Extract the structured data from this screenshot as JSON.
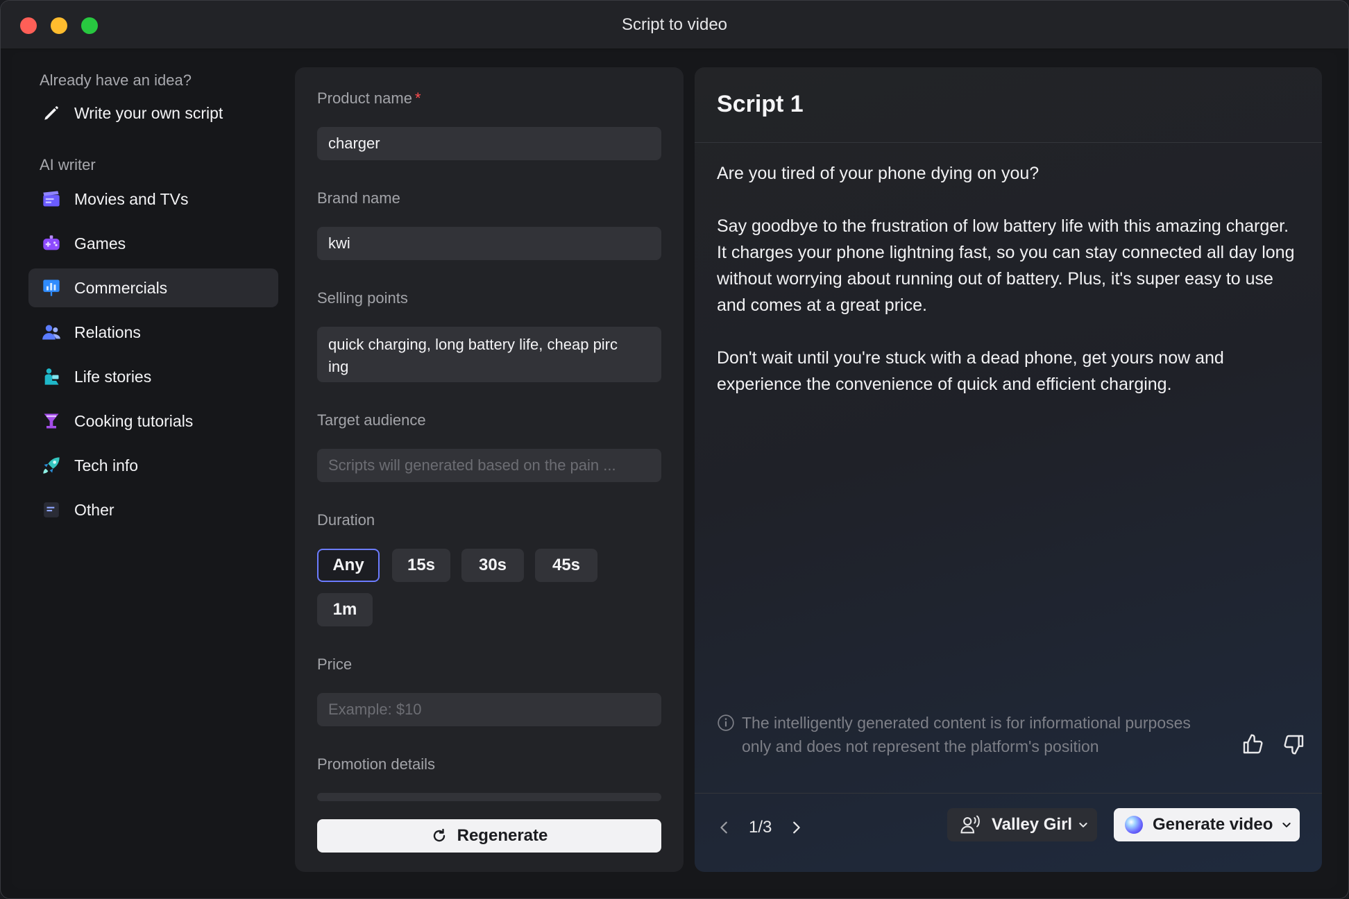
{
  "window": {
    "title": "Script to video"
  },
  "sidebar": {
    "heading_idea": "Already have an idea?",
    "write_own": "Write your own script",
    "heading_ai": "AI writer",
    "items": [
      {
        "label": "Movies and TVs",
        "icon": "clapperboard-icon",
        "active": false
      },
      {
        "label": "Games",
        "icon": "gamepad-icon",
        "active": false
      },
      {
        "label": "Commercials",
        "icon": "chart-board-icon",
        "active": true
      },
      {
        "label": "Relations",
        "icon": "people-icon",
        "active": false
      },
      {
        "label": "Life stories",
        "icon": "person-reading-icon",
        "active": false
      },
      {
        "label": "Cooking tutorials",
        "icon": "cocktail-glass-icon",
        "active": false
      },
      {
        "label": "Tech info",
        "icon": "rocket-icon",
        "active": false
      },
      {
        "label": "Other",
        "icon": "list-icon",
        "active": false
      }
    ]
  },
  "form": {
    "product_name_label": "Product name",
    "required_mark": "*",
    "product_name_value": "charger",
    "brand_name_label": "Brand name",
    "brand_name_value": "kwi",
    "selling_points_label": "Selling points",
    "selling_points_line1": "quick charging, long battery life, cheap pirc",
    "selling_points_line2": "ing",
    "target_audience_label": "Target audience",
    "target_audience_placeholder": "Scripts will generated based on the pain ...",
    "duration_label": "Duration",
    "duration_options": [
      "Any",
      "15s",
      "30s",
      "45s",
      "1m"
    ],
    "duration_selected": "Any",
    "price_label": "Price",
    "price_placeholder": "Example: $10",
    "promotion_label": "Promotion details",
    "regenerate_label": "Regenerate"
  },
  "script": {
    "title": "Script 1",
    "paragraphs": [
      "Are you tired of your phone dying on you?",
      "Say goodbye to the frustration of low battery life with this amazing charger. It charges your phone lightning fast, so you can stay connected all day long without worrying about running out of battery. Plus, it's super easy to use and comes at a great price.",
      "Don't wait until you're stuck with a dead phone, get yours now and experience the convenience of quick and efficient charging."
    ],
    "disclaimer": "The intelligently generated content is for informational purposes only and does not represent the platform's position",
    "pager": "1/3",
    "voice_label": "Valley Girl",
    "generate_label": "Generate video"
  },
  "colors": {
    "accent_border": "#6c7cff",
    "required": "#ff4d4f",
    "active_item_bg": "#2a2b30"
  }
}
